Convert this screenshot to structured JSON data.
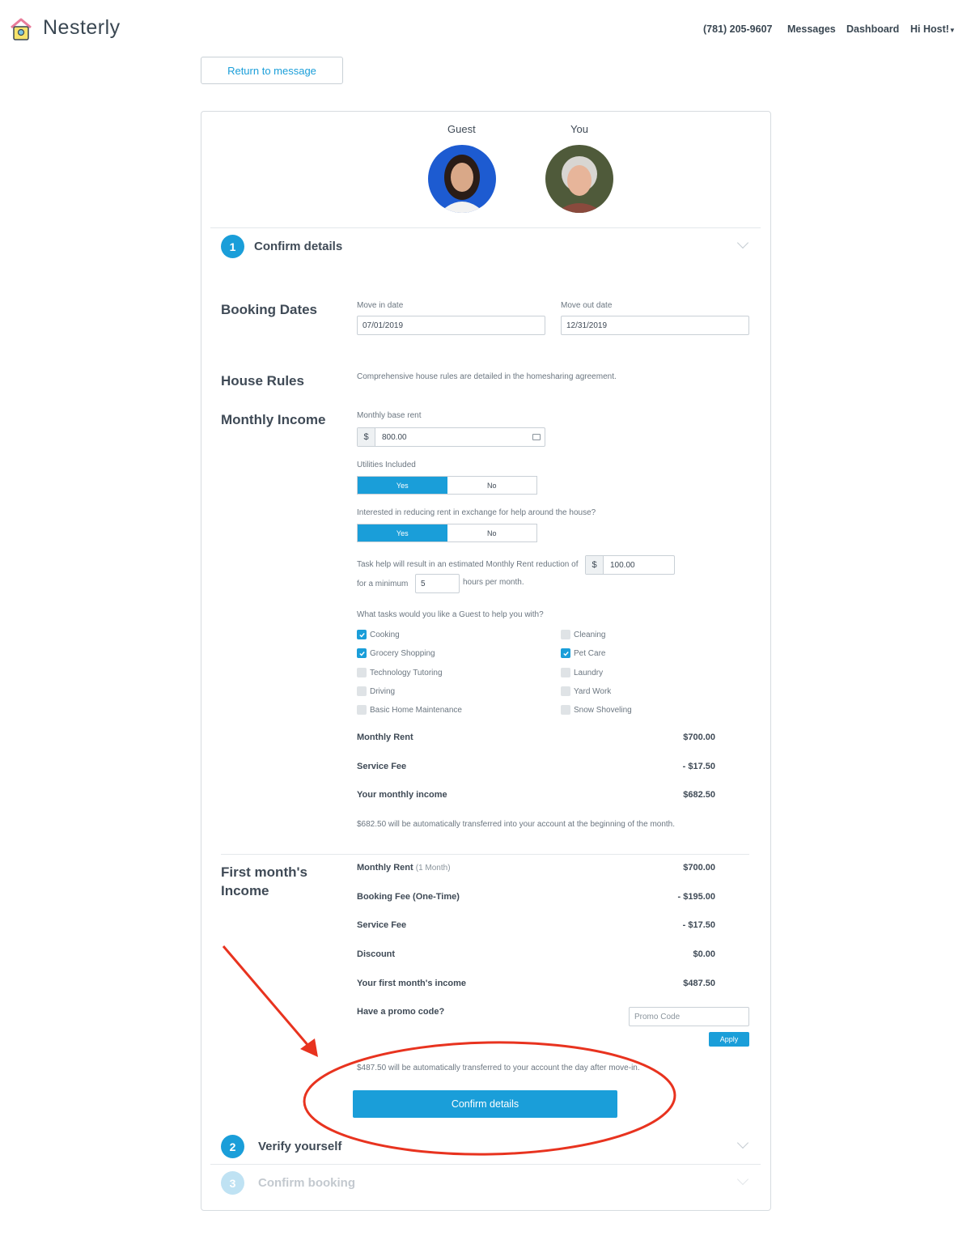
{
  "brand": {
    "name": "Nesterly"
  },
  "nav": {
    "phone": "(781) 205-9607",
    "messages": "Messages",
    "dashboard": "Dashboard",
    "user_menu": "Hi Host!"
  },
  "return_button": "Return to message",
  "participants": {
    "guest_label": "Guest",
    "you_label": "You"
  },
  "steps": [
    {
      "number": "1",
      "title": "Confirm details"
    },
    {
      "number": "2",
      "title": "Verify yourself"
    },
    {
      "number": "3",
      "title": "Confirm booking"
    }
  ],
  "booking_dates": {
    "title": "Booking Dates",
    "move_in_label": "Move in date",
    "move_in_value": "07/01/2019",
    "move_out_label": "Move out date",
    "move_out_value": "12/31/2019"
  },
  "house_rules": {
    "title": "House Rules",
    "text": "Comprehensive house rules are detailed in the homesharing agreement."
  },
  "monthly_income": {
    "title": "Monthly Income",
    "base_rent_label": "Monthly base rent",
    "currency": "$",
    "base_rent_value": "800.00",
    "utilities_label": "Utilities Included",
    "reduce_label": "Interested in reducing rent in exchange for help around the house?",
    "yes": "Yes",
    "no": "No",
    "task_help_text": "Task help will result in an estimated Monthly Rent reduction of",
    "reduction_value": "100.00",
    "minimum_prefix": "for a minimum",
    "minimum_hours": "5",
    "minimum_suffix": "hours per month.",
    "tasks_label": "What tasks would you like a Guest to help you with?",
    "tasks_left": [
      {
        "label": "Cooking",
        "checked": true
      },
      {
        "label": "Grocery Shopping",
        "checked": true
      },
      {
        "label": "Technology Tutoring",
        "checked": false
      },
      {
        "label": "Driving",
        "checked": false
      },
      {
        "label": "Basic Home Maintenance",
        "checked": false
      }
    ],
    "tasks_right": [
      {
        "label": "Cleaning",
        "checked": false
      },
      {
        "label": "Pet Care",
        "checked": true
      },
      {
        "label": "Laundry",
        "checked": false
      },
      {
        "label": "Yard Work",
        "checked": false
      },
      {
        "label": "Snow Shoveling",
        "checked": false
      }
    ],
    "summary": [
      {
        "label": "Monthly Rent",
        "value": "$700.00"
      },
      {
        "label": "Service Fee",
        "value": "- $17.50"
      },
      {
        "label": "Your monthly income",
        "value": "$682.50"
      }
    ],
    "note": "$682.50 will be automatically transferred into your account at the beginning of the month."
  },
  "first_month": {
    "title_line1": "First month's",
    "title_line2": "Income",
    "rows": [
      {
        "label": "Monthly Rent",
        "sub": "(1 Month)",
        "value": "$700.00"
      },
      {
        "label": "Booking Fee (One-Time)",
        "sub": "",
        "value": "- $195.00"
      },
      {
        "label": "Service Fee",
        "sub": "",
        "value": "- $17.50"
      },
      {
        "label": "Discount",
        "sub": "",
        "value": "$0.00"
      },
      {
        "label": "Your first month's income",
        "sub": "",
        "value": "$487.50"
      }
    ],
    "promo_label": "Have a promo code?",
    "promo_placeholder": "Promo Code",
    "apply": "Apply",
    "note": "$487.50 will be automatically transferred to your account the day after move-in."
  },
  "confirm_button": "Confirm details",
  "colors": {
    "accent": "#1a9ed9",
    "annotation": "#e8331f"
  }
}
